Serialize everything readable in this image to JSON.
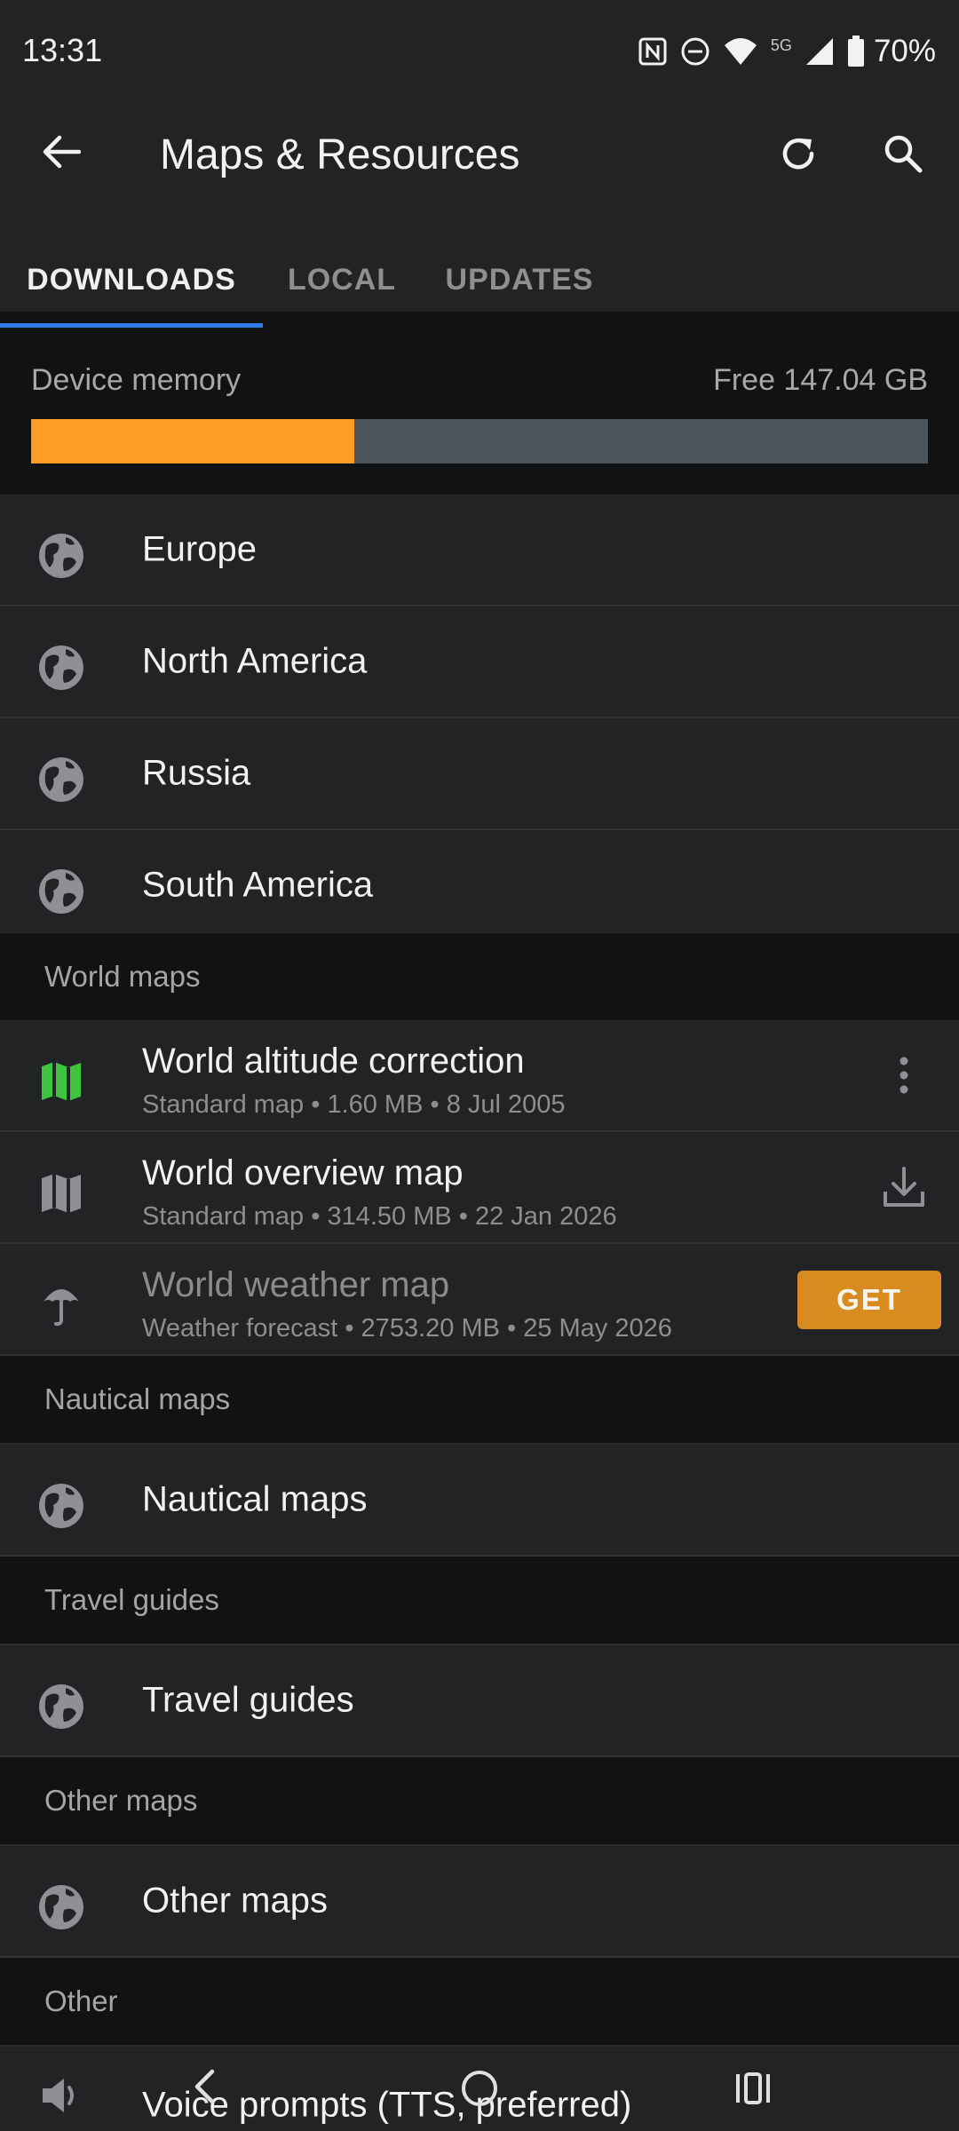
{
  "status_bar": {
    "time": "13:31",
    "network": "5G",
    "battery": "70%"
  },
  "app_bar": {
    "title": "Maps & Resources"
  },
  "tabs": [
    {
      "label": "DOWNLOADS",
      "active": true
    },
    {
      "label": "LOCAL",
      "active": false
    },
    {
      "label": "UPDATES",
      "active": false
    }
  ],
  "memory": {
    "label": "Device memory",
    "free": "Free 147.04 GB",
    "used_fraction": 0.36,
    "used_color": "#ff9b26"
  },
  "regions": [
    "Europe",
    "North America",
    "Russia",
    "South America"
  ],
  "sections": {
    "world_maps": "World maps",
    "nautical": "Nautical maps",
    "travel": "Travel guides",
    "other_maps": "Other maps",
    "other": "Other"
  },
  "world_maps": [
    {
      "title": "World altitude correction",
      "subtitle": "Standard map • 1.60 MB • 8 Jul 2005",
      "icon": "map-icon-green",
      "action": "more-vert-icon"
    },
    {
      "title": "World overview map",
      "subtitle": "Standard map • 314.50 MB • 22 Jan 2026",
      "icon": "map-icon",
      "action": "download-icon"
    },
    {
      "title": "World weather map",
      "subtitle": "Weather forecast • 2753.20 MB • 25 May 2026",
      "icon": "umbrella-icon",
      "action_label": "GET"
    }
  ],
  "nautical_item": "Nautical maps",
  "travel_item": "Travel guides",
  "other_maps_item": "Other maps",
  "voice_item": "Voice prompts (TTS, preferred)",
  "colors": {
    "accent": "#2f7be6",
    "map_green": "#3ec43e",
    "get_button": "#d88b1e"
  }
}
